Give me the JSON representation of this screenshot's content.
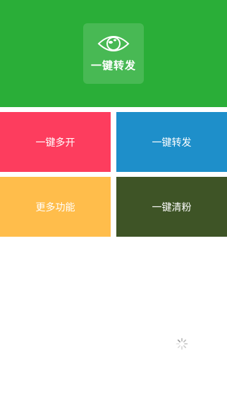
{
  "header": {
    "background": "#2aae38",
    "logo": {
      "icon": "eye-icon",
      "label": "一键转发"
    }
  },
  "tiles": [
    {
      "label": "一键多开",
      "color": "#fd3d5e"
    },
    {
      "label": "一键转发",
      "color": "#1e8fca"
    },
    {
      "label": "更多功能",
      "color": "#ffbd4b"
    },
    {
      "label": "一键清粉",
      "color": "#3e5426"
    }
  ],
  "loading": {
    "icon": "loading-spinner-icon"
  }
}
